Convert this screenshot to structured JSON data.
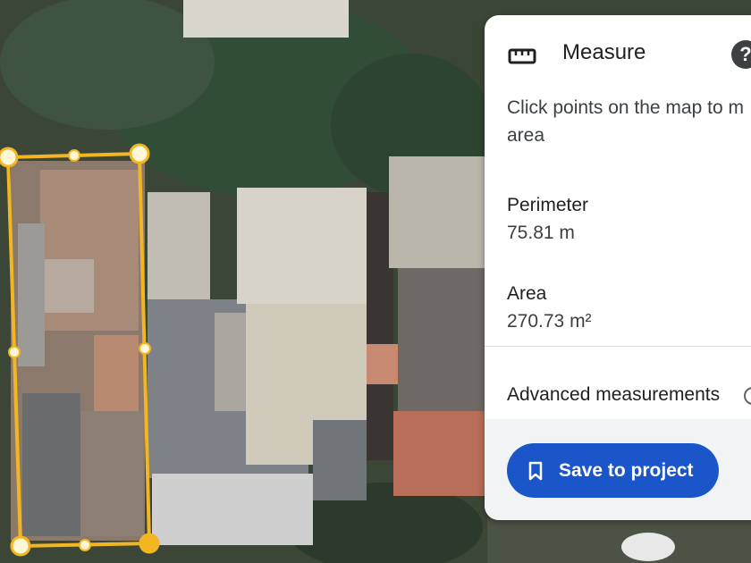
{
  "panel": {
    "title": "Measure",
    "help_icon": "help-icon",
    "ruler_icon": "ruler-icon",
    "instructions": "Click points on the map to m area",
    "perimeter_label": "Perimeter",
    "perimeter_value": "75.81 m",
    "area_label": "Area",
    "area_value": "270.73 m²",
    "advanced_label": "Advanced measurements",
    "save_label": "Save to project"
  },
  "colors": {
    "accent": "#1a56c9",
    "polygon": "#f2b623",
    "handle_fill": "#fff7d6"
  }
}
